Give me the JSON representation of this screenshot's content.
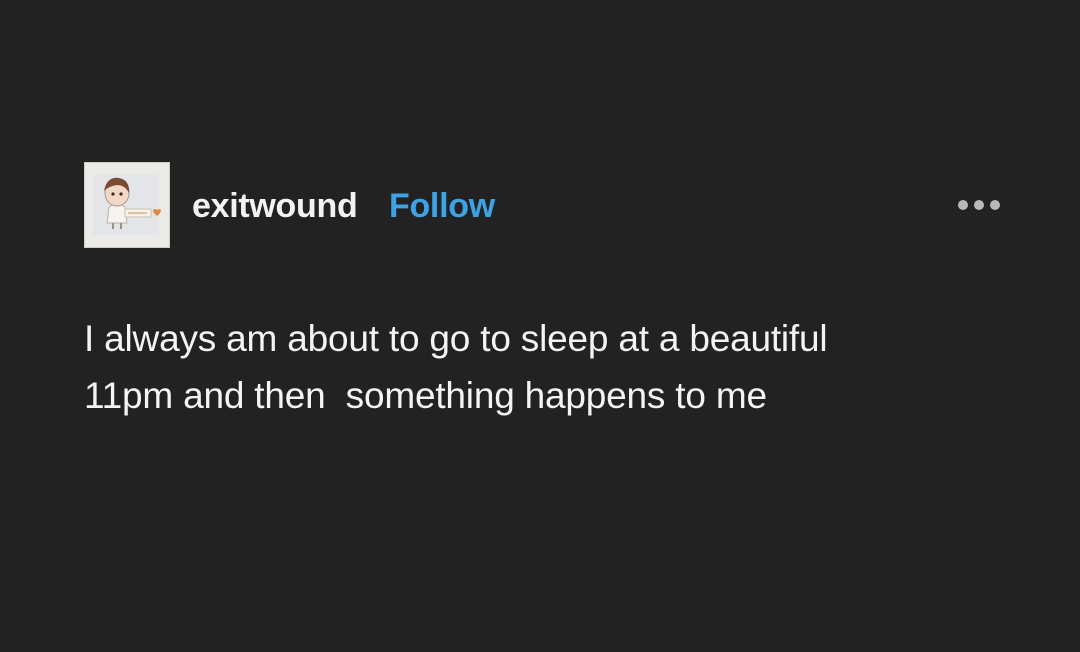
{
  "post": {
    "author": {
      "name": "exitwound",
      "follow_label": "Follow",
      "avatar_icon": "avatar-illustration-icon"
    },
    "more_icon": "more-options-icon",
    "body_text": "I always am about to go to sleep at a beautiful\n11pm and then  something happens to me"
  },
  "colors": {
    "background": "#222223",
    "text": "#f4f4f4",
    "follow_accent": "#3ea3e6",
    "more_dots": "#b9b9b9"
  }
}
